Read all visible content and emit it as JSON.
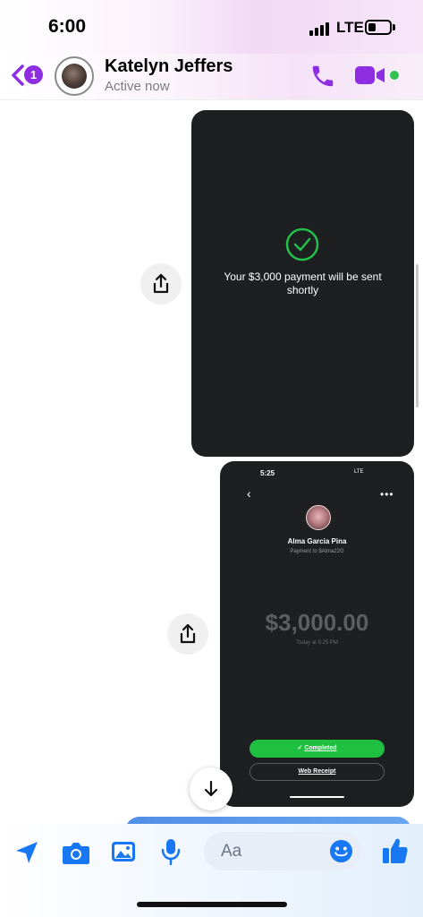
{
  "status_bar": {
    "time": "6:00",
    "network": "LTE",
    "icons": [
      "signal-icon",
      "battery-icon"
    ]
  },
  "header": {
    "back_badge": "1",
    "contact_name": "Katelyn Jeffers",
    "status": "Active now",
    "icons": [
      "back-chevron-icon",
      "phone-icon",
      "video-camera-icon"
    ],
    "accent_color": "#8e2de2",
    "online_color": "#31c24d"
  },
  "messages": [
    {
      "type": "image",
      "text": "Your $3,000 payment will be sent shortly",
      "icon": "check-circle-icon"
    },
    {
      "type": "image",
      "inner_time": "5:25",
      "inner_status": "LTE",
      "recipient_name": "Alma Garcia Pina",
      "recipient_sub": "Payment to $Alma22G",
      "amount": "$3,000.00",
      "amount_time": "Today at 5:25 PM",
      "completed_label": "Completed",
      "receipt_label": "Web Receipt",
      "completed_color": "#1fbf3f"
    }
  ],
  "composer": {
    "placeholder": "Aa",
    "icons": [
      "location-icon",
      "camera-icon",
      "gallery-icon",
      "microphone-icon",
      "emoji-icon",
      "thumbs-up-icon"
    ],
    "accent_color": "#1877f2"
  }
}
